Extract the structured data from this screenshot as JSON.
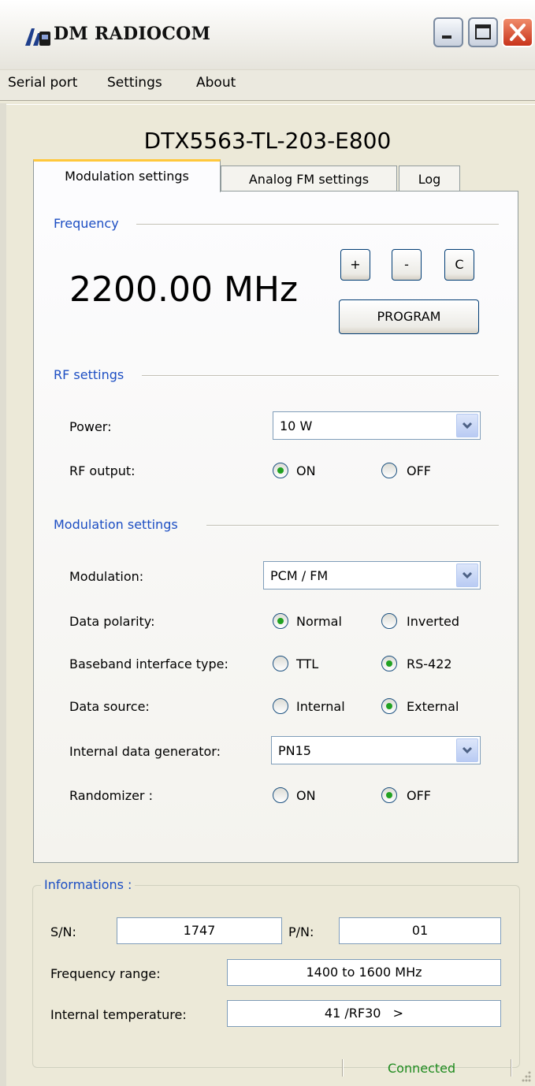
{
  "window": {
    "title": "DM RADIOCOM"
  },
  "menu": [
    "Serial port",
    "Settings",
    "About"
  ],
  "device_title": "DTX5563-TL-203-E800",
  "tabs": [
    "Modulation settings",
    "Analog FM settings",
    "Log"
  ],
  "frequency": {
    "section_title": "Frequency",
    "value": "2200.00 MHz",
    "plus_label": "+",
    "minus_label": "-",
    "clear_label": "C",
    "program_label": "PROGRAM"
  },
  "rf": {
    "section_title": "RF settings",
    "power_label": "Power:",
    "power_value": "10 W",
    "output_label": "RF output:",
    "output_on": "ON",
    "output_off": "OFF"
  },
  "modulation": {
    "section_title": "Modulation settings",
    "modulation_label": "Modulation:",
    "modulation_value": "PCM / FM",
    "polarity_label": "Data polarity:",
    "polarity_normal": "Normal",
    "polarity_inverted": "Inverted",
    "baseband_label": "Baseband interface type:",
    "baseband_ttl": "TTL",
    "baseband_rs422": "RS-422",
    "source_label": "Data source:",
    "source_internal": "Internal",
    "source_external": "External",
    "generator_label": "Internal data generator:",
    "generator_value": "PN15",
    "randomizer_label": "Randomizer :",
    "randomizer_on": "ON",
    "randomizer_off": "OFF"
  },
  "info": {
    "title": "Informations :",
    "sn_label": "S/N:",
    "sn_value": "1747",
    "pn_label": "P/N:",
    "pn_value": "01",
    "range_label": "Frequency range:",
    "range_value": "1400 to 1600 MHz",
    "temp_label": "Internal temperature:",
    "temp_value": "41 /RF30   >"
  },
  "status": {
    "connection": "Connected"
  },
  "colors": {
    "section_title": "#1c4ec3",
    "status_connected": "#1d8a1d",
    "close_button": "#c8331b",
    "active_tab_accent": "#ffc83c",
    "radio_selected": "#21a121"
  }
}
